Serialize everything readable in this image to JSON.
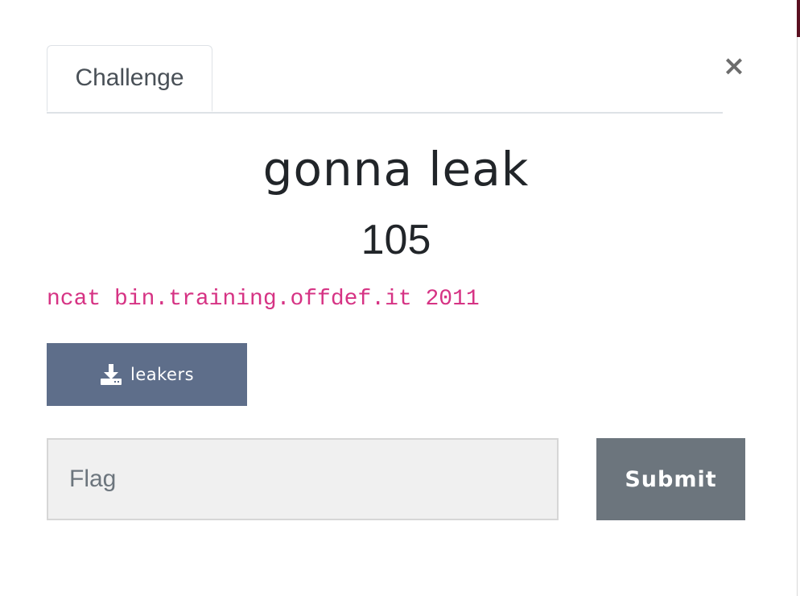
{
  "tabs": [
    {
      "label": "Challenge",
      "active": true
    }
  ],
  "close": {
    "label": "×"
  },
  "challenge": {
    "name": "gonna leak",
    "points": "105",
    "description": "ncat bin.training.offdef.it 2011"
  },
  "download": {
    "icon": "download-icon",
    "label": "leakers"
  },
  "flag": {
    "placeholder": "Flag",
    "value": ""
  },
  "submit": {
    "label": "Submit"
  },
  "colors": {
    "description": "#d63384",
    "download_button": "#5e6e8a",
    "submit_button": "#6c757d",
    "input_background": "#f0f0f0"
  }
}
